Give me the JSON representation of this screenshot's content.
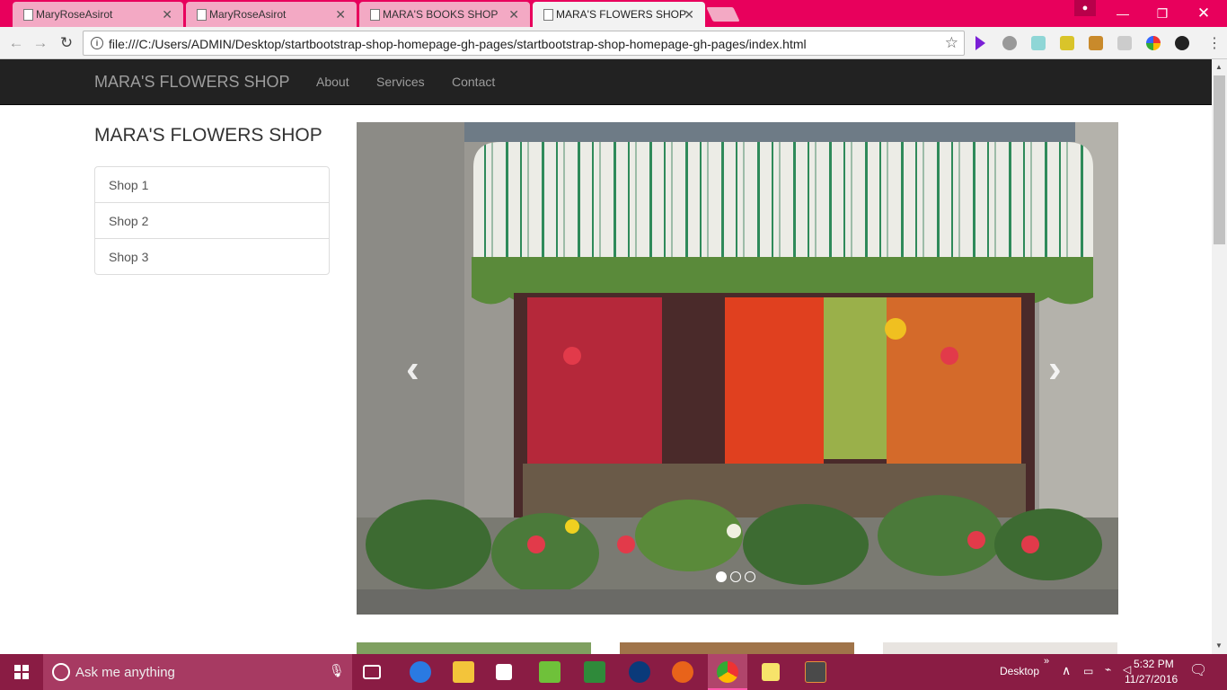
{
  "browser": {
    "tabs": [
      {
        "title": "MaryRoseAsirot",
        "active": false
      },
      {
        "title": "MaryRoseAsirot",
        "active": false
      },
      {
        "title": "MARA'S BOOKS SHOP",
        "active": false
      },
      {
        "title": "MARA'S FLOWERS SHOP",
        "active": true
      }
    ],
    "url": "file:///C:/Users/ADMIN/Desktop/startbootstrap-shop-homepage-gh-pages/startbootstrap-shop-homepage-gh-pages/index.html",
    "accent_color": "#e8005c"
  },
  "site": {
    "brand": "MARA'S FLOWERS SHOP",
    "nav": [
      "About",
      "Services",
      "Contact"
    ],
    "sidebar_title": "MARA'S FLOWERS SHOP",
    "shops": [
      "Shop 1",
      "Shop 2",
      "Shop 3"
    ],
    "carousel": {
      "slides": 3,
      "active_slide": 1
    }
  },
  "taskbar": {
    "search_placeholder": "Ask me anything",
    "desktop_label": "Desktop",
    "time": "5:32 PM",
    "date": "11/27/2016"
  }
}
